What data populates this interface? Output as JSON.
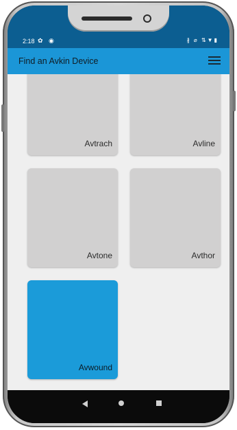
{
  "status_bar": {
    "time": "2:18",
    "left_icons": [
      "gear-icon",
      "at-icon"
    ],
    "left_icons_text": "✿ ◉",
    "right_icons": [
      "bluetooth-icon",
      "mute-icon",
      "data-icon",
      "wifi-icon",
      "battery-icon"
    ],
    "right_icons_text": "∦ ⌀ ⇅▼▮"
  },
  "app_bar": {
    "title": "Find an Avkin Device",
    "menu_icon": "hamburger-menu-icon",
    "color": "#1b96d7"
  },
  "devices": [
    {
      "label": "Avtrach",
      "selected": false
    },
    {
      "label": "Avline",
      "selected": false
    },
    {
      "label": "Avtone",
      "selected": false
    },
    {
      "label": "Avthor",
      "selected": false
    },
    {
      "label": "Avwound",
      "selected": true
    }
  ],
  "colors": {
    "tile": "#d1d0d0",
    "selected_tile": "#1b9bd9",
    "background": "#efefef"
  },
  "nav_bar": {
    "buttons": [
      "back-icon",
      "home-icon",
      "recents-icon"
    ]
  }
}
